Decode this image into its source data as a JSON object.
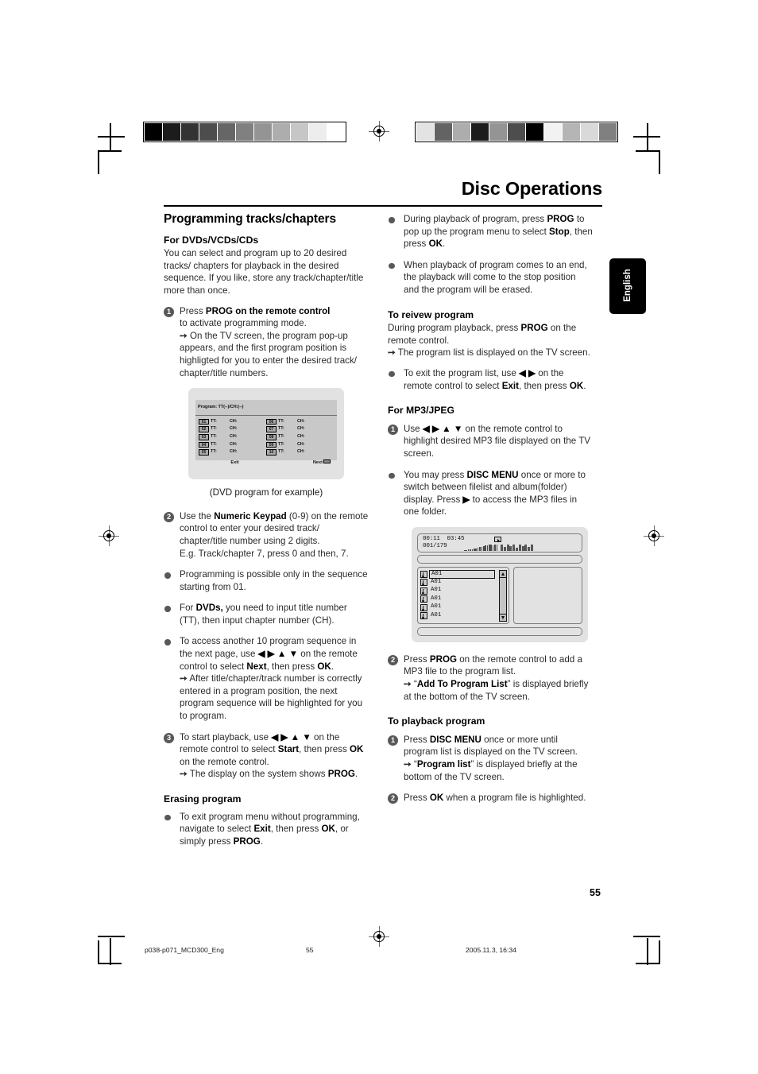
{
  "document": {
    "chapter_title": "Disc Operations",
    "language_tab": "English",
    "page_number": "55",
    "footer": {
      "filename": "p038-p071_MCD300_Eng",
      "page": "55",
      "date": "2005.11.3, 16:34"
    }
  },
  "colorbars": {
    "left": [
      "#000000",
      "#1c1c1c",
      "#333333",
      "#4d4d4d",
      "#666666",
      "#808080",
      "#949494",
      "#adadad",
      "#c6c6c6",
      "#ededed",
      "#ffffff"
    ],
    "right": [
      "#e3e3e3",
      "#636363",
      "#adadad",
      "#1c1c1c",
      "#949494",
      "#4d4d4d",
      "#000000",
      "#f2f2f2",
      "#b5b5b5",
      "#d9d9d9",
      "#808080"
    ]
  },
  "left_column": {
    "heading": "Programming tracks/chapters",
    "sub_dvd": "For DVDs/VCDs/CDs",
    "intro": "You can select and program up to 20 desired tracks/ chapters for playback in the desired sequence.  If you like, store any track/chapter/title more than once.",
    "step1": {
      "num": "1",
      "line1_a": "Press ",
      "line1_b": "PROG",
      "line1_c": " on the remote control",
      "line2": "to activate programming mode.",
      "result": "On the TV screen, the program pop-up appears, and the first program position is highligted for you to enter the desired track/ chapter/title numbers."
    },
    "figure_dvd": {
      "header": "Program: TT(--)/CH:(--)",
      "rows_left": [
        {
          "index": "01",
          "tt": "TT:",
          "ch": "CH:"
        },
        {
          "index": "02",
          "tt": "TT:",
          "ch": "CH:"
        },
        {
          "index": "03",
          "tt": "TT:",
          "ch": "CH:"
        },
        {
          "index": "04",
          "tt": "TT:",
          "ch": "CH:"
        },
        {
          "index": "05",
          "tt": "TT:",
          "ch": "CH:"
        }
      ],
      "rows_right": [
        {
          "index": "06",
          "tt": "TT:",
          "ch": "CH:"
        },
        {
          "index": "07",
          "tt": "TT:",
          "ch": "CH:"
        },
        {
          "index": "08",
          "tt": "TT:",
          "ch": "CH:"
        },
        {
          "index": "09",
          "tt": "TT:",
          "ch": "CH:"
        },
        {
          "index": "10",
          "tt": "TT:",
          "ch": "CH:"
        }
      ],
      "exit_label": "Exit",
      "next_label": "Next"
    },
    "caption": "(DVD program for example)",
    "step2": {
      "num": "2",
      "a": "Use the ",
      "b": "Numeric Keypad",
      "c": " (0-9) on the remote control to enter your desired track/ chapter/title number using 2 digits.",
      "d": "E.g. Track/chapter 7, press 0 and then, 7."
    },
    "bullet1": "Programming is possible only in the sequence starting from 01.",
    "bullet2": {
      "a": "For ",
      "b": "DVDs,",
      "c": " you need to input title number (TT), then input chapter number (CH)."
    },
    "bullet3": {
      "a": "To access another 10 program sequence in the next page, use ",
      "arrows": "◀ ▶ ▲ ▼",
      "b": " on the remote control to select ",
      "c": "Next",
      "d": ", then press ",
      "e": "OK",
      "f": ".",
      "result": "After title/chapter/track number is correctly entered in a program position, the next program sequence will be highlighted for you to program."
    },
    "step3": {
      "num": "3",
      "a": "To start playback, use ",
      "arrows": "◀ ▶ ▲ ▼",
      "b": " on the remote control to select ",
      "c": "Start",
      "d": ", then press ",
      "e": "OK",
      "f": " on the remote control.",
      "result_a": "The display on the system shows ",
      "result_b": "PROG",
      "result_c": "."
    },
    "erasing_heading": "Erasing program",
    "erase_bullet": {
      "a": "To exit program menu without programming, navigate to select ",
      "b": "Exit",
      "c": ", then press ",
      "d": "OK",
      "e": ", or simply press ",
      "f": "PROG",
      "g": "."
    }
  },
  "right_column": {
    "bullet1": {
      "a": "During playback of program, press ",
      "b": "PROG",
      "c": " to pop up the program menu to select ",
      "d": "Stop",
      "e": ", then press ",
      "f": "OK",
      "g": "."
    },
    "bullet2": "When playback of program comes to an end, the playback will come to the stop position and the program will be erased.",
    "review_heading": "To reivew program",
    "review_body_a": "During program playback, press ",
    "review_body_b": "PROG",
    "review_body_c": " on the remote control.",
    "review_result": "The program list is displayed on the TV screen.",
    "exit_bullet": {
      "a": "To exit the program list, use ",
      "arrows": "◀ ▶",
      "b": " on the remote control to select ",
      "c": "Exit",
      "d": ", then press ",
      "e": "OK",
      "f": "."
    },
    "mp3_heading": "For MP3/JPEG",
    "mp3_step1": {
      "num": "1",
      "a": "Use ",
      "arrows": "◀ ▶ ▲ ▼",
      "b": " on the remote control to highlight desired MP3 file displayed on the TV screen."
    },
    "mp3_bullet": {
      "a": "You may press ",
      "b": "DISC MENU",
      "c": " once or more to switch between filelist and album(folder) display. Press ",
      "arrow": "▶",
      "d": " to access the MP3 files in one folder."
    },
    "figure_mp3": {
      "elapsed": "00:11",
      "total": "03:45",
      "track_counter": "001/179",
      "play_icon": "play-icon",
      "items": [
        "A01",
        "A01",
        "A01",
        "A01",
        "A01",
        "A01"
      ]
    },
    "mp3_step2": {
      "num": "2",
      "a": "Press ",
      "b": "PROG",
      "c": " on the remote control to add a MP3 file to the program list.",
      "result_a": "“",
      "result_b": "Add To Program List",
      "result_c": "” is displayed briefly at the bottom of the TV screen."
    },
    "playback_heading": "To playback program",
    "pb_step1": {
      "num": "1",
      "a": "Press ",
      "b": "DISC MENU",
      "c": " once or more until program list is displayed on the TV screen.",
      "result_a": "“",
      "result_b": "Program list",
      "result_c": "” is displayed briefly at the bottom of the TV screen."
    },
    "pb_step2": {
      "num": "2",
      "a": "Press ",
      "b": "OK",
      "c": " when a program file is highlighted."
    }
  }
}
